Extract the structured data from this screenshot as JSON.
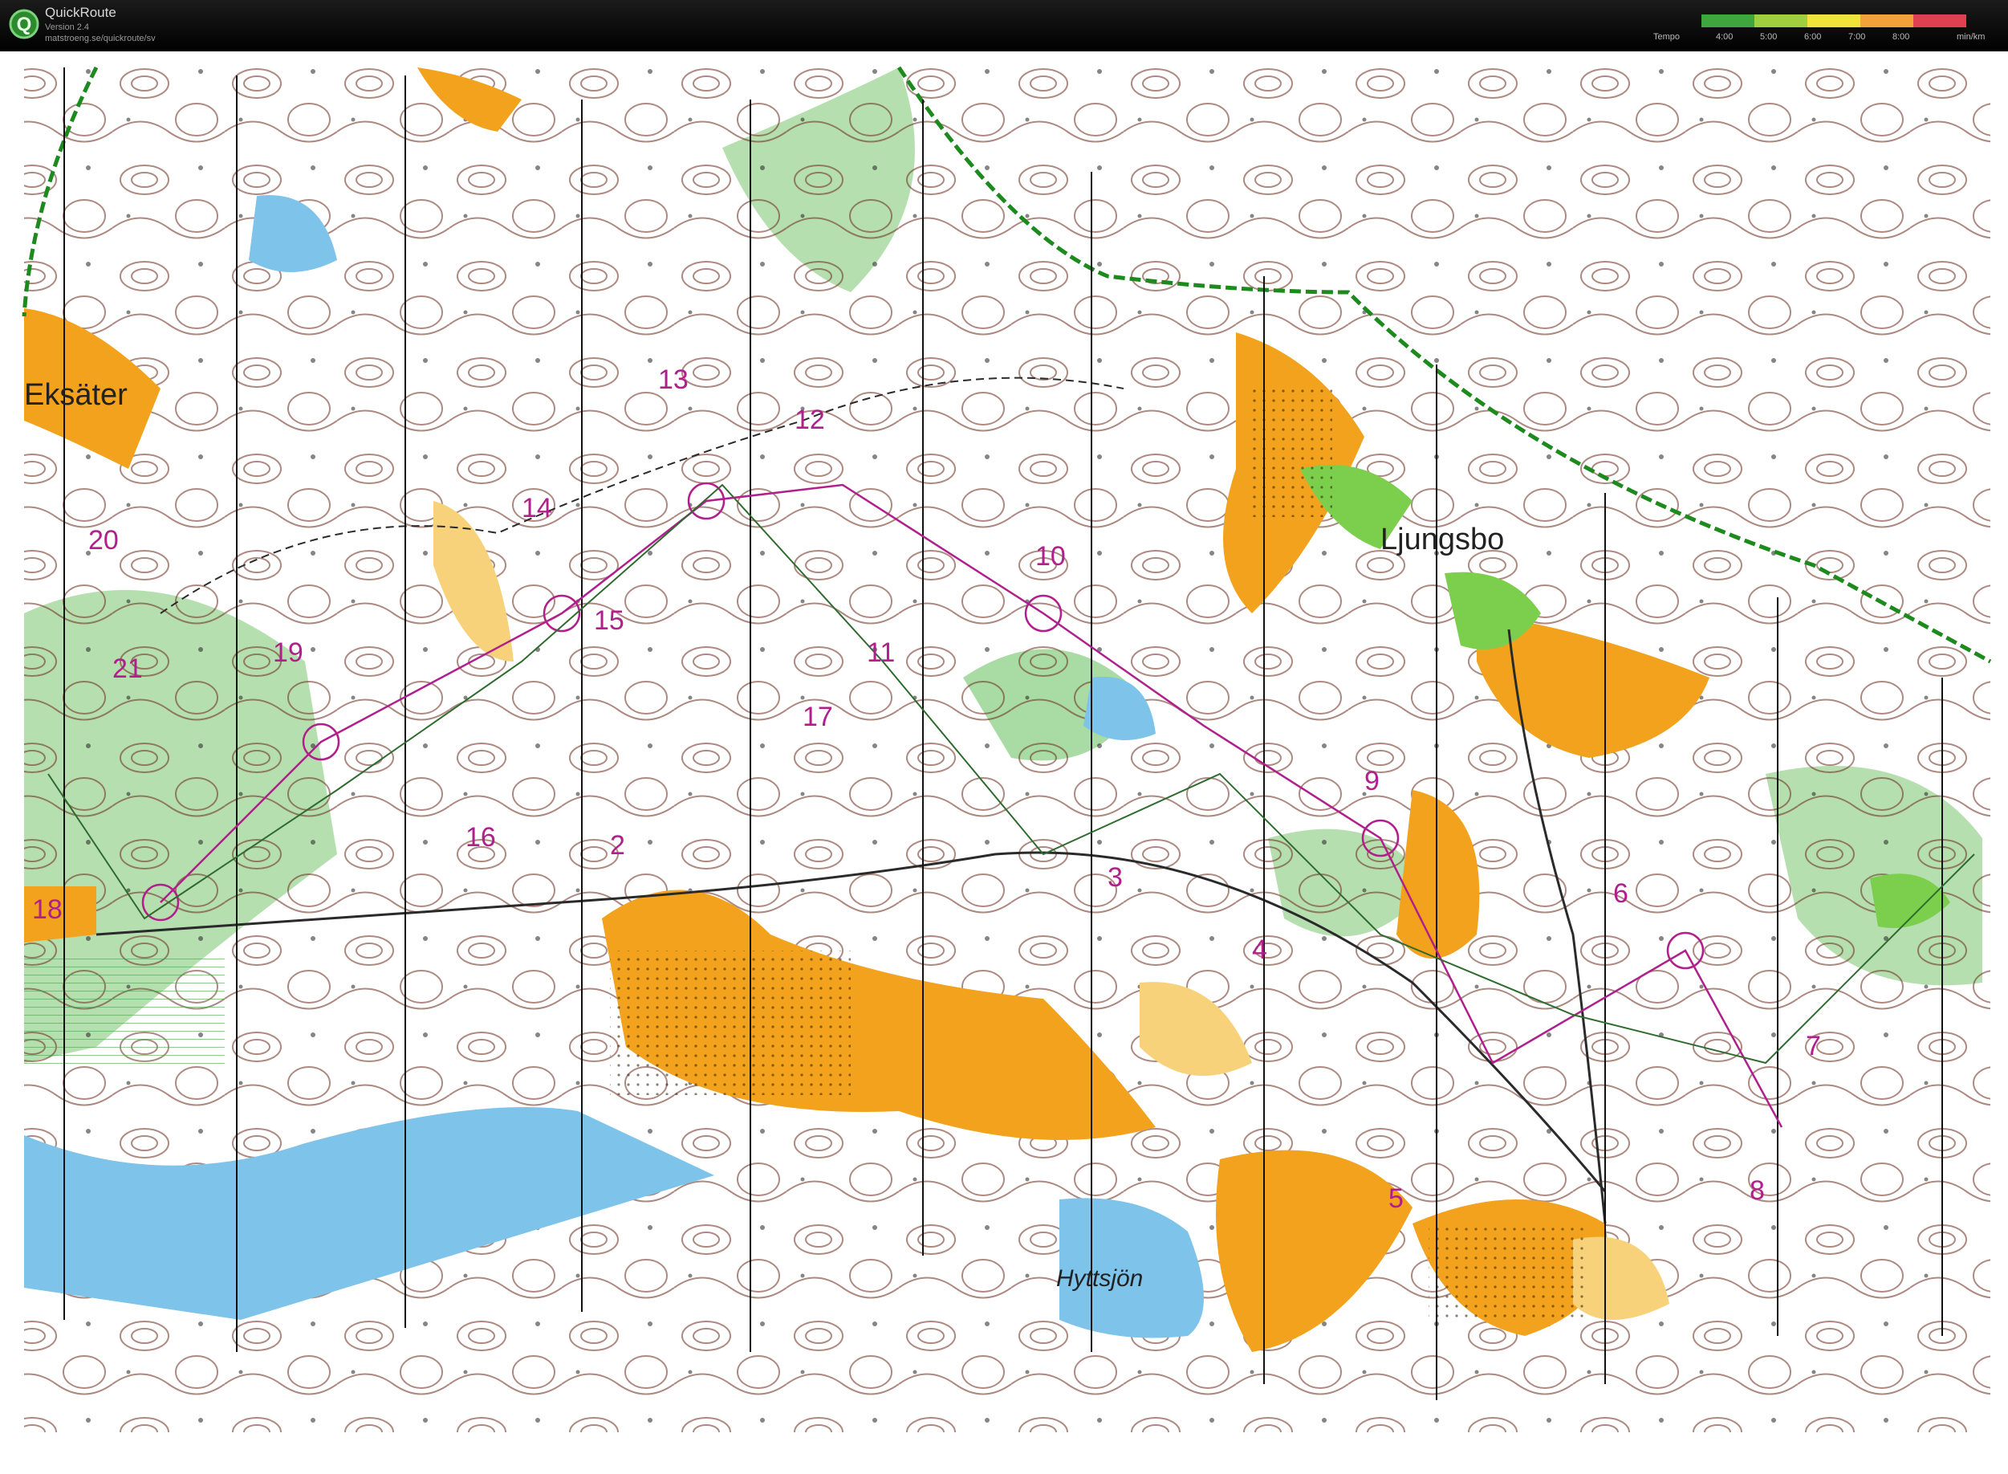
{
  "app": {
    "name": "QuickRoute",
    "version": "Version 2.4",
    "url": "matstroeng.se/quickroute/sv"
  },
  "legend": {
    "title": "Tempo",
    "ticks": [
      "4:00",
      "5:00",
      "6:00",
      "7:00",
      "8:00"
    ],
    "unit": "min/km",
    "colors": [
      "#3fa53f",
      "#9fcf3f",
      "#f2e23a",
      "#f2a23a",
      "#e0404f"
    ]
  },
  "map": {
    "place_names": [
      "Eksäter",
      "Ljungsbo",
      "Hyttsjön"
    ],
    "control_numbers": [
      "21",
      "20",
      "19",
      "18",
      "17",
      "16",
      "15",
      "14",
      "13",
      "12",
      "11",
      "10",
      "9",
      "8",
      "7",
      "6",
      "5",
      "4",
      "3",
      "2"
    ],
    "colors": {
      "paper": "#ffffff",
      "forest_green": "#9fd49a",
      "open_land": "#f2a21c",
      "rough_open": "#f7d27a",
      "water": "#7ec3ea",
      "contour": "#6a2a1a",
      "course": "#b01f8c",
      "route": "#2f6b2f",
      "boundary": "#1c8a1c"
    }
  }
}
